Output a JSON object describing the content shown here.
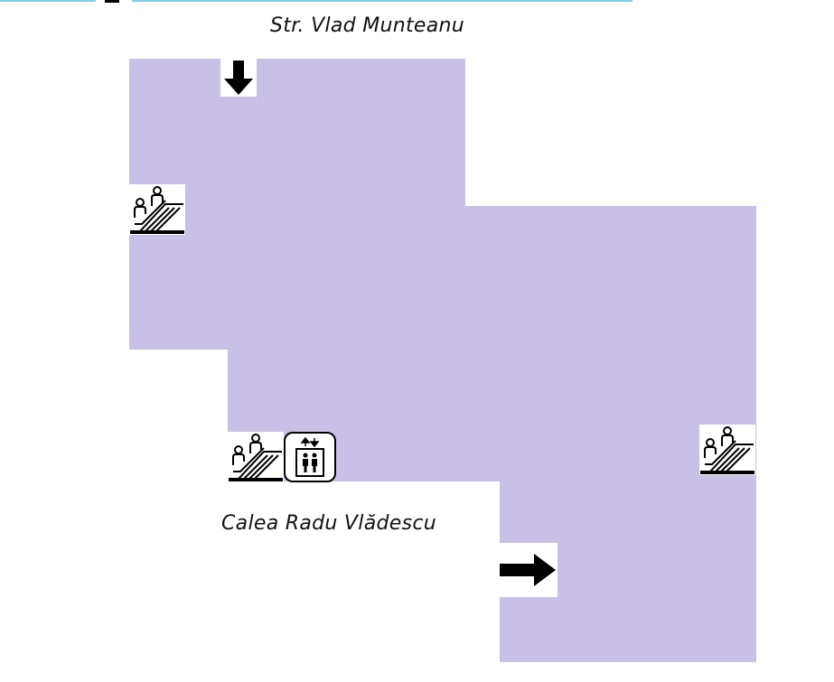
{
  "map": {
    "colors": {
      "floor": "#c8c0e6",
      "background": "#ffffff",
      "accent_line": "#7fd0e8",
      "icon": "#000000"
    },
    "streets": {
      "top": "Str. Vlad Munteanu",
      "bottom": "Calea Radu Vlădescu"
    },
    "icons": {
      "entrance_top": "arrow-down-icon",
      "entrance_right": "arrow-right-icon",
      "escalator": "escalator-icon",
      "elevator": "elevator-icon"
    }
  }
}
